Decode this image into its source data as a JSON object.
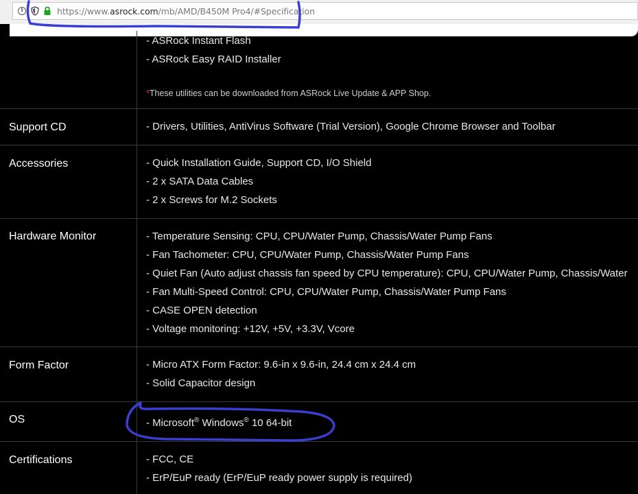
{
  "browser": {
    "url_prefix": "https://www.",
    "url_host": "asrock.com",
    "url_path": "/mb/AMD/B450M Pro4/#Specification",
    "info_glyph": "i"
  },
  "spec": {
    "software": {
      "items": [
        "- ASRock Instant Flash",
        "- ASRock Easy RAID Installer"
      ],
      "note_star": "*",
      "note": "These utilities can be downloaded from ASRock Live Update & APP Shop."
    },
    "support_cd": {
      "label": "Support CD",
      "items": [
        "- Drivers, Utilities, AntiVirus Software (Trial Version), Google Chrome Browser and Toolbar"
      ]
    },
    "accessories": {
      "label": "Accessories",
      "items": [
        "- Quick Installation Guide, Support CD, I/O Shield",
        "- 2 x SATA Data Cables",
        "- 2 x Screws for M.2 Sockets"
      ]
    },
    "hardware_monitor": {
      "label": "Hardware Monitor",
      "items": [
        "- Temperature Sensing: CPU, CPU/Water Pump, Chassis/Water Pump Fans",
        "- Fan Tachometer: CPU, CPU/Water Pump, Chassis/Water Pump Fans",
        "- Quiet Fan (Auto adjust chassis fan speed by CPU temperature): CPU, CPU/Water Pump, Chassis/Water",
        "- Fan Multi-Speed Control: CPU, CPU/Water Pump, Chassis/Water Pump Fans",
        "- CASE OPEN detection",
        "- Voltage monitoring: +12V, +5V, +3.3V, Vcore"
      ]
    },
    "form_factor": {
      "label": "Form Factor",
      "items": [
        "- Micro ATX Form Factor: 9.6-in x 9.6-in, 24.4 cm x 24.4 cm",
        "- Solid Capacitor design"
      ]
    },
    "os": {
      "label": "OS",
      "part1": "- Microsoft",
      "reg1": "®",
      "part2": " Windows",
      "reg2": "®",
      "part3": " 10 64-bit"
    },
    "certifications": {
      "label": "Certifications",
      "items": [
        "- FCC, CE",
        "- ErP/EuP ready (ErP/EuP ready power supply is required)"
      ]
    }
  },
  "colors": {
    "page_bg": "#000000",
    "annotation": "#3b3fd0",
    "note_star": "#e03030"
  }
}
